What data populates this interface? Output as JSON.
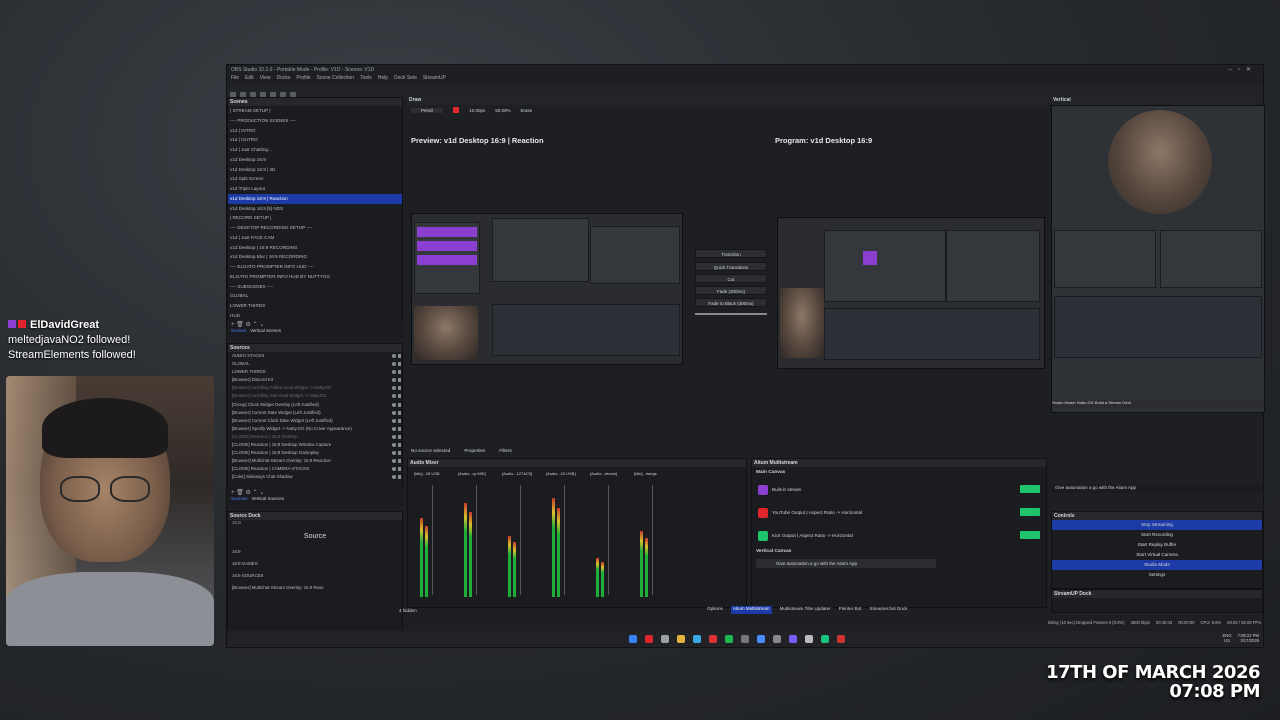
{
  "window": {
    "title": "OBS Studio 32.1.0 - Portable Mode - Profile: V1D - Scenes: V1D",
    "menu": [
      "File",
      "Edit",
      "View",
      "Docks",
      "Profile",
      "Scene Collection",
      "Tools",
      "Help",
      "Dock Sets",
      "StreamUP"
    ]
  },
  "scenes": {
    "header": "Scenes",
    "items": [
      "| STREAM SETUP |",
      "---- PRODUCTION SCENES ----",
      "v1d | INTRO",
      "v1d | OUTRO",
      "v1d | Just Chatting...",
      "v1d Desktop 16:9",
      "v1d Desktop 16:9 | 3D",
      "v1d Split Screen",
      "v1d Triple Layout",
      "v1d Desktop 16:9 | Reaction",
      "v1d Desktop 16:9 [5] NDS",
      "| RECORD SETUP |",
      "---- DESKTOP RECORDING SETUP ----",
      "v1d | Just FACE CAM",
      "v1d Desktop | 16:9 RECORDING",
      "v1d Desktop Blur | 16:9 RECORDING",
      "---- ELGATO PROMPTER INFO HUD ----",
      "ELGATO PROMPTER INFO HUD BY NUTTYGG",
      "---- SUBSCENES ----",
      "GLOBAL",
      "LOWER THIRDS",
      "HUD"
    ],
    "selected_index": 9,
    "tabs": [
      "Scenes",
      "Vertical Scenes"
    ]
  },
  "sources": {
    "header": "Sources",
    "items": [
      "AUDIO STACKS",
      "GLOBAL",
      "LOWER THIRDS",
      "[Browser] Discord Kit",
      "[Browser] Scrolling Follow Goal Widget -> NuttyGG",
      "[Browser] Scrolling Sub Goal Widget -> NuttyGG",
      "[Group] Clock Widget Overlay (Left Justified)",
      "[Browser] Current Date Widget (Left Justified)",
      "[Browser] Current Clock Date Widget (Left Justified)",
      "[Browser] Spotify Widget -> Nutty.GG (No Cover Appearance)",
      "[CLONE] Reaction | 16:9 Desktop",
      "[CLONE] Reaction | 16:9 Desktop Window Capture",
      "[CLONE] Reaction | 16:9 Desktop Gameplay",
      "[Browser] Multichat-Stream Overlay: 16:9 Reaction",
      "[CLONE] Reaction | CAMERA-STACKS",
      "[Color] Sideways Chat Shadow"
    ],
    "dim_indices": [
      4,
      5,
      10
    ],
    "tabs": [
      "Sources",
      "Vertical Sources"
    ]
  },
  "source_dock": {
    "header": "Source Dock",
    "subtitle": "16:9",
    "label": "Source",
    "items": [
      "16:9",
      "16:9 GAMES",
      "16:9 SOURCES",
      "[Browser] Multichat-Stream Overlay: 16:9 Reac"
    ]
  },
  "draw": {
    "header": "Draw",
    "tool": "Pencil",
    "size": "10,00px",
    "opacity": "50,00%",
    "erase": "Erase"
  },
  "preview": {
    "label": "Preview: v1d Desktop 16:9 | Reaction",
    "program_label": "Program: v1d Desktop 16:9"
  },
  "transitions": {
    "transition": "Transition",
    "quick": "Quick Transitions",
    "cut": "Cut",
    "fade": "Fade (300ms)",
    "fade_black": "Fade to Black (300ms)"
  },
  "properties_bar": {
    "status": "No source selected",
    "properties": "Properties",
    "filters": "Filters"
  },
  "audio_mixer": {
    "header": "Audio Mixer",
    "tracks": [
      "[Mic]...28 USB",
      "[Audio...rp MSI]",
      "[Audio...127AC5]",
      "[Audio...20 USB]",
      "[Audio...drums]",
      "[Mic]...hangs"
    ],
    "levels": [
      0.72,
      0.85,
      0.55,
      0.9,
      0.35,
      0.6
    ],
    "hidden": "4 hidden"
  },
  "bottom_tabs": [
    "Options",
    "Aitum Multistream",
    "Multistream Title Updater",
    "Pointer Bot",
    "Streamer.bot Dock"
  ],
  "multistream": {
    "header": "Aitum Multistream",
    "main_canvas": "Main Canvas",
    "outputs": [
      "Built-in stream",
      "YouTube Output | Aspect Ratio -> Horizontal",
      "Kick Output | Aspect Ratio -> Horizontal"
    ],
    "vertical_canvas": "Vertical Canvas",
    "vertical_msg": "Give automation a go with the Aitum App"
  },
  "vertical": {
    "header": "Vertical",
    "ticker": "Studio Moder Nuttu.GG Build a Stream Deck",
    "promo": "Give automation a go with the Aitum App"
  },
  "controls": {
    "header": "Controls",
    "buttons": [
      "Stop Streaming",
      "Start Recording",
      "Start Replay Buffer",
      "Start Virtual Camera",
      "Studio Mode",
      "Settings"
    ],
    "active": [
      0,
      4
    ]
  },
  "streamup": {
    "header": "StreamUP Dock"
  },
  "statusbar": {
    "text": "Delay (10 sec)  Dropped Frames 0 (0.0%)",
    "bitrate": "3600 kbps",
    "time": "00:40:43",
    "rec": "00:00:00",
    "cpu": "CPU: 8.6%",
    "fps": "60.00 / 60.00 FPS"
  },
  "taskbar": {
    "lang": "ENG",
    "region": "US",
    "clock": "7:08:22 PM",
    "date": "3/17/2026"
  },
  "chat": {
    "user": "ElDavidGreat",
    "lines": [
      "meltedjavaNO2 followed!",
      "StreamElements followed!"
    ]
  },
  "overlay_date": {
    "date": "17TH OF MARCH 2026",
    "time": "07:08 PM"
  },
  "colors": {
    "selection": "#1d3ba6",
    "accent_purple": "#8a3fd1",
    "toggle_green": "#20c46a",
    "meter_green": "#1fae3a",
    "live_red": "#e0262d"
  }
}
